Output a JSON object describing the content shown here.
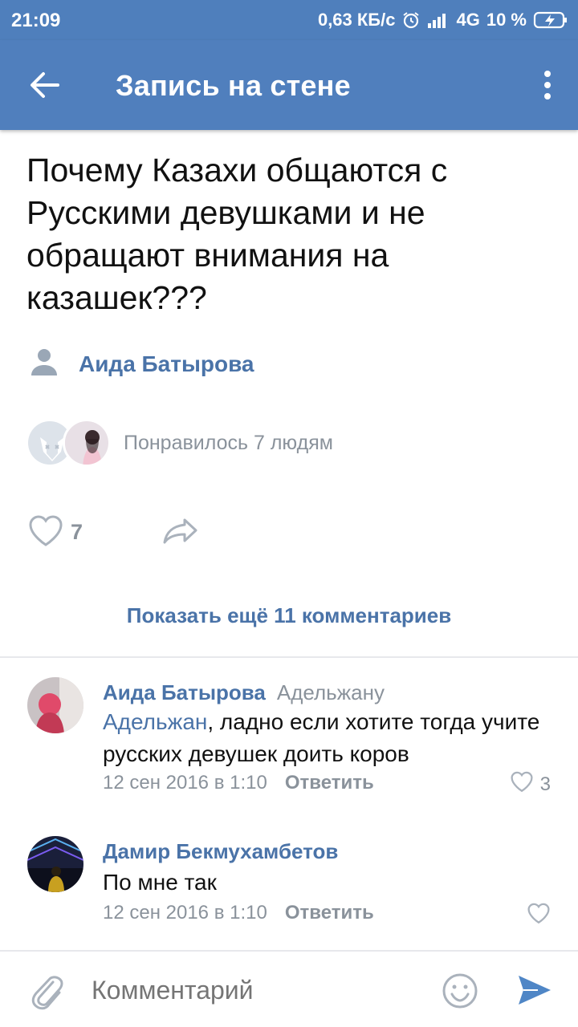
{
  "status": {
    "time": "21:09",
    "speed": "0,63 КБ/с",
    "network": "4G",
    "battery": "10 %"
  },
  "appbar": {
    "title": "Запись на стене"
  },
  "post": {
    "text": "Почему Казахи общаются с Русскими девушками и не обращают внимания на казашек???",
    "author": "Аида Батырова",
    "liked_text": "Понравилось 7 людям",
    "like_count": "7"
  },
  "comments_section": {
    "show_more": "Показать ещё 11 комментариев"
  },
  "comments": [
    {
      "name": "Аида Батырова",
      "reply_to": "Адельжану",
      "mention": "Адельжан",
      "text": ", ладно если хотите тогда учите русских девушек доить коров",
      "date": "12 сен 2016 в 1:10",
      "reply_label": "Ответить",
      "likes": "3"
    },
    {
      "name": "Дамир Бекмухамбетов",
      "text": "По мне так",
      "date": "12 сен 2016 в 1:10",
      "reply_label": "Ответить"
    }
  ],
  "composer": {
    "placeholder": "Комментарий"
  },
  "colors": {
    "brand": "#507fbd",
    "link": "#4a73a8",
    "muted": "#8a929b"
  }
}
